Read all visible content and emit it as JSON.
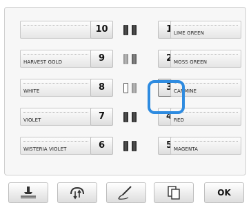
{
  "rows": [
    {
      "left_label": "",
      "left_num": "10",
      "right_num": "1",
      "right_label": "LIME GREEN"
    },
    {
      "left_label": "HARVEST GOLD",
      "left_num": "9",
      "right_num": "2",
      "right_label": "MOSS GREEN"
    },
    {
      "left_label": "WHITE",
      "left_num": "8",
      "right_num": "3",
      "right_label": "CARMINE"
    },
    {
      "left_label": "VIOLET",
      "left_num": "7",
      "right_num": "4",
      "right_label": "RED"
    },
    {
      "left_label": "WISTERIA VIOLET",
      "left_num": "6",
      "right_num": "5",
      "right_label": "MAGENTA"
    }
  ],
  "selected_spool": "3",
  "highlight_color": "#2e8be0",
  "footer": {
    "buttons": [
      {
        "icon": "presser-foot-icon"
      },
      {
        "icon": "thread-swap-icon"
      },
      {
        "icon": "needle-threader-icon"
      },
      {
        "icon": "copy-icon"
      }
    ],
    "ok_label": "OK"
  }
}
